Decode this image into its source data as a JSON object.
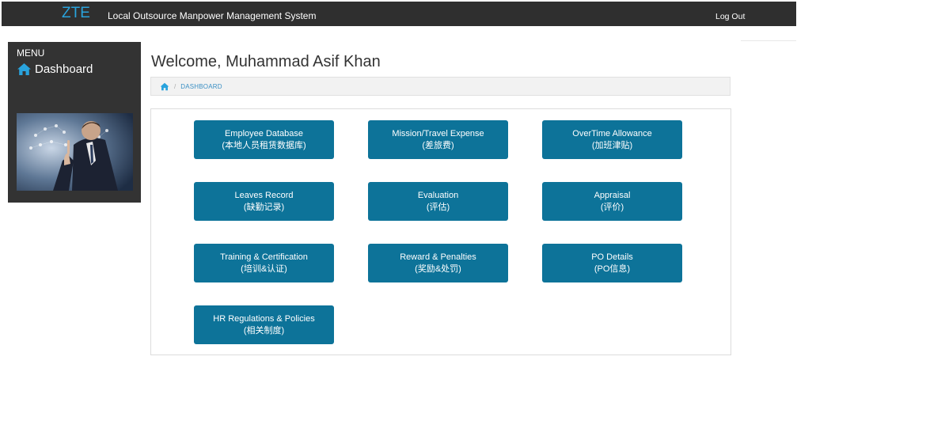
{
  "header": {
    "brand": "ZTE",
    "system_title": "Local Outsource Manpower Management System",
    "logout_label": "Log Out"
  },
  "sidebar": {
    "menu_label": "MENU",
    "dashboard_label": "Dashboard"
  },
  "main": {
    "welcome": "Welcome, Muhammad Asif Khan",
    "breadcrumb": {
      "separator": "/",
      "current": "DASHBOARD"
    },
    "tiles": [
      {
        "title": "Employee Database",
        "subtitle": "(本地人员租赁数据库)"
      },
      {
        "title": "Mission/Travel Expense",
        "subtitle": "(差旅费)"
      },
      {
        "title": "OverTime Allowance",
        "subtitle": "(加班津贴)"
      },
      {
        "title": "Leaves Record",
        "subtitle": "(缺勤记录)"
      },
      {
        "title": "Evaluation",
        "subtitle": "(评估)"
      },
      {
        "title": "Appraisal",
        "subtitle": "(评价)"
      },
      {
        "title": "Training & Certification",
        "subtitle": "(培训&认证)"
      },
      {
        "title": "Reward & Penalties",
        "subtitle": "(奖励&处罚)"
      },
      {
        "title": "PO Details",
        "subtitle": "(PO信息)"
      },
      {
        "title": "HR Regulations & Policies",
        "subtitle": "(相关制度)"
      }
    ]
  },
  "colors": {
    "topbar": "#2f2f2f",
    "brand": "#29a3dd",
    "tile": "#0d7399",
    "sidebar": "#333333"
  },
  "icons": [
    "home-icon",
    "breadcrumb-home-icon"
  ]
}
